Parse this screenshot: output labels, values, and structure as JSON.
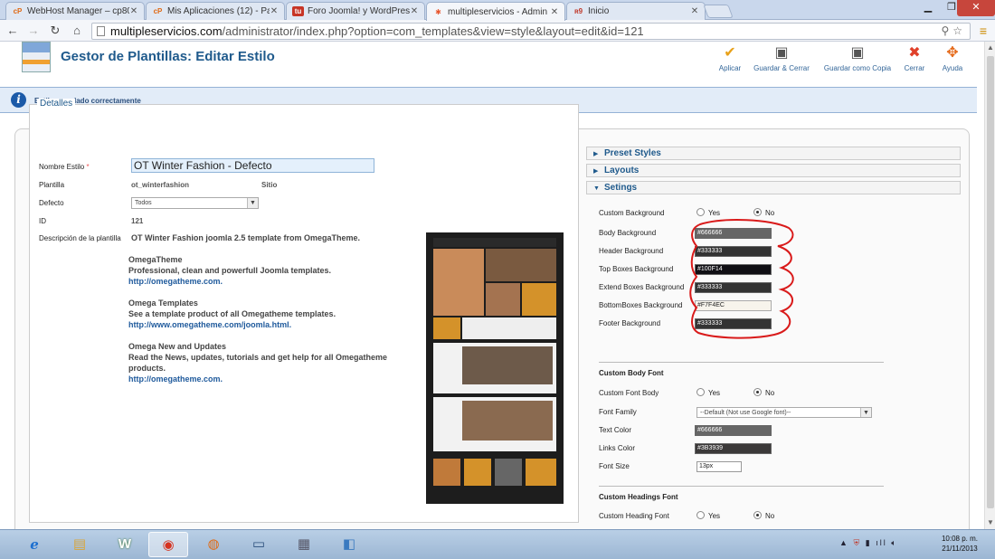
{
  "browser": {
    "tabs": [
      {
        "icon": "cpanel-icon",
        "icon_text": "cP",
        "label": "WebHost Manager – cp80",
        "active": false
      },
      {
        "icon": "cpanel-icon",
        "icon_text": "cP",
        "label": "Mis Aplicaciones (12) - Pa",
        "active": false
      },
      {
        "icon": "forum-icon",
        "icon_text": "tu",
        "label": "Foro Joomla! y WordPress",
        "active": false
      },
      {
        "icon": "joomla-icon",
        "icon_text": "✱",
        "label": "multipleservicios - Admin",
        "active": true
      },
      {
        "icon": "inicio-icon",
        "icon_text": "ʀ9",
        "label": "Inicio",
        "active": false
      }
    ],
    "url_host": "multipleservicios.com",
    "url_path": "/administrator/index.php?option=com_templates&view=style&layout=edit&id=121"
  },
  "header": {
    "title": "Gestor de Plantillas: Editar Estilo",
    "buttons": [
      {
        "name": "apply-button",
        "icon": "check-icon",
        "glyph": "✔",
        "color": "#e8a11a",
        "label": "Aplicar"
      },
      {
        "name": "save-close-button",
        "icon": "save-icon",
        "glyph": "▣",
        "color": "#555555",
        "label": "Guardar & Cerrar"
      },
      {
        "name": "save-copy-button",
        "icon": "save-copy-icon",
        "glyph": "▣",
        "color": "#555555",
        "label": "Guardar como Copia"
      },
      {
        "name": "close-button",
        "icon": "cancel-icon",
        "glyph": "✖",
        "color": "#e0402a",
        "label": "Cerrar"
      },
      {
        "name": "help-button",
        "icon": "help-icon",
        "glyph": "✥",
        "color": "#e56a1a",
        "label": "Ayuda"
      }
    ]
  },
  "message": "Estilo guardado correctamente",
  "details": {
    "legend": "Detalles",
    "style_name_label": "Nombre Estilo",
    "style_name_value": "OT Winter Fashion - Defecto",
    "template_label": "Plantilla",
    "template_value": "ot_winterfashion",
    "site_value": "Sitio",
    "default_label": "Defecto",
    "default_value": "Todos",
    "id_label": "ID",
    "id_value": "121",
    "desc_label": "Descripción de la plantilla",
    "desc_intro": "OT Winter Fashion joomla 2.5 template from OmegaTheme.",
    "desc_block1_title": "OmegaTheme",
    "desc_block1_text": "Professional, clean and powerfull Joomla templates.",
    "desc_block1_link": "http://omegatheme.com.",
    "desc_block2_title": "Omega Templates",
    "desc_block2_text": "See a template product of all Omegatheme templates.",
    "desc_block2_link": "http://www.omegatheme.com/joomla.html.",
    "desc_block3_title": "Omega New and Updates",
    "desc_block3_text1": "Read the News, updates, tutorials and get help for all Omegatheme",
    "desc_block3_text2": "products.",
    "desc_block3_link": "http://omegatheme.com."
  },
  "accordion": {
    "preset": "Preset Styles",
    "layouts": "Layouts",
    "settings": "Setings"
  },
  "settings": {
    "yes": "Yes",
    "no": "No",
    "custom_background": "Custom Background",
    "colors": [
      {
        "label": "Body Background",
        "value": "#666666"
      },
      {
        "label": "Header Background",
        "value": "#333333"
      },
      {
        "label": "Top Boxes Background",
        "value": "#100F14"
      },
      {
        "label": "Extend Boxes Background",
        "value": "#333333"
      },
      {
        "label": "BottomBoxes Background",
        "value": "#F7F4EC"
      },
      {
        "label": "Footer Background",
        "value": "#333333"
      }
    ],
    "body_font_section": "Custom Body Font",
    "custom_font_body": "Custom Font Body",
    "font_family_label": "Font Family",
    "font_family_value": "--Default (Not use Google font)--",
    "text_color_label": "Text Color",
    "text_color_value": "#666666",
    "links_color_label": "Links Color",
    "links_color_value": "#3B3939",
    "font_size_label": "Font Size",
    "font_size_value": "13px",
    "headings_section": "Custom Headings Font",
    "custom_heading_font": "Custom Heading Font"
  },
  "taskbar": {
    "clock_time": "10:08 p. m.",
    "clock_date": "21/11/2013"
  }
}
